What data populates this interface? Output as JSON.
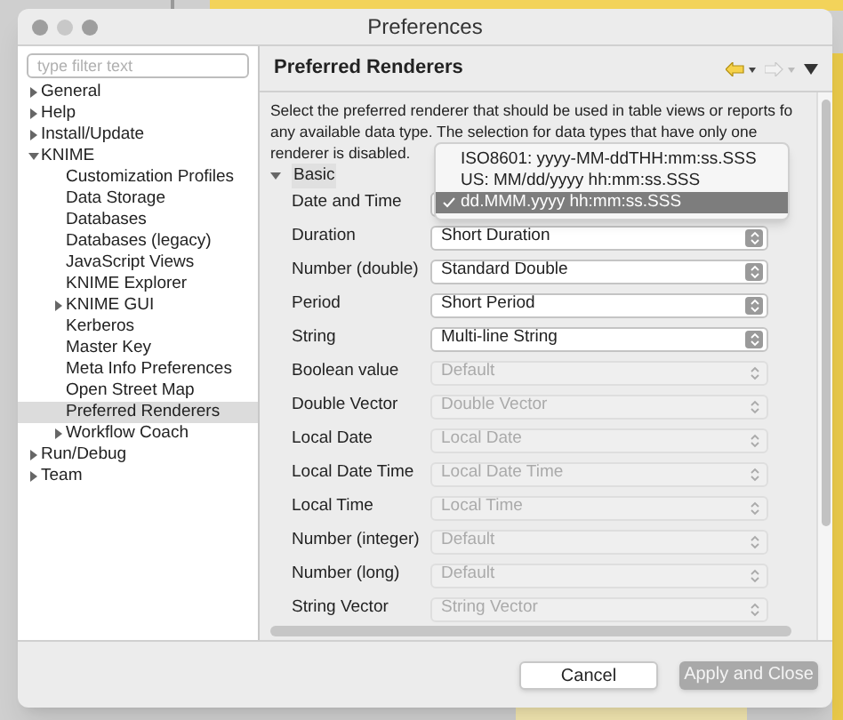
{
  "window": {
    "title": "Preferences"
  },
  "filter": {
    "placeholder": "type filter text"
  },
  "tree": [
    {
      "label": "General",
      "expanded": false,
      "selected": false
    },
    {
      "label": "Help",
      "expanded": false,
      "selected": false
    },
    {
      "label": "Install/Update",
      "expanded": false,
      "selected": false
    },
    {
      "label": "KNIME",
      "expanded": true,
      "selected": false,
      "children": [
        {
          "label": "Customization Profiles",
          "selected": false
        },
        {
          "label": "Data Storage",
          "selected": false
        },
        {
          "label": "Databases",
          "selected": false
        },
        {
          "label": "Databases (legacy)",
          "selected": false
        },
        {
          "label": "JavaScript Views",
          "selected": false
        },
        {
          "label": "KNIME Explorer",
          "selected": false
        },
        {
          "label": "KNIME GUI",
          "expanded": false,
          "selected": false
        },
        {
          "label": "Kerberos",
          "selected": false
        },
        {
          "label": "Master Key",
          "selected": false
        },
        {
          "label": "Meta Info Preferences",
          "selected": false
        },
        {
          "label": "Open Street Map",
          "selected": false
        },
        {
          "label": "Preferred Renderers",
          "selected": true
        },
        {
          "label": "Workflow Coach",
          "expanded": false,
          "selected": false
        }
      ]
    },
    {
      "label": "Run/Debug",
      "expanded": false,
      "selected": false
    },
    {
      "label": "Team",
      "expanded": false,
      "selected": false
    }
  ],
  "page": {
    "title": "Preferred Renderers",
    "description": [
      "Select the preferred renderer that should be used in table views or reports fo",
      "any available data type. The selection for data types that have only one",
      "renderer is disabled."
    ],
    "section": {
      "label": "Basic",
      "expanded": true
    },
    "rows": [
      {
        "label": "Date and Time",
        "disabled": false
      },
      {
        "label": "Duration",
        "value": "Short Duration",
        "disabled": false
      },
      {
        "label": "Number (double)",
        "value": "Standard Double",
        "disabled": false
      },
      {
        "label": "Period",
        "value": "Short Period",
        "disabled": false
      },
      {
        "label": "String",
        "value": "Multi-line String",
        "disabled": false
      },
      {
        "label": "Boolean value",
        "value": "Default",
        "disabled": true
      },
      {
        "label": "Double Vector",
        "value": "Double Vector",
        "disabled": true
      },
      {
        "label": "Local Date",
        "value": "Local Date",
        "disabled": true
      },
      {
        "label": "Local Date Time",
        "value": "Local Date Time",
        "disabled": true
      },
      {
        "label": "Local Time",
        "value": "Local Time",
        "disabled": true
      },
      {
        "label": "Number (integer)",
        "value": "Default",
        "disabled": true
      },
      {
        "label": "Number (long)",
        "value": "Default",
        "disabled": true
      },
      {
        "label": "String Vector",
        "value": "String Vector",
        "disabled": true
      }
    ],
    "popup": {
      "options": [
        {
          "label": "ISO8601: yyyy-MM-ddTHH:mm:ss.SSS",
          "selected": false
        },
        {
          "label": "US: MM/dd/yyyy hh:mm:ss.SSS",
          "selected": false
        },
        {
          "label": "dd.MMM.yyyy hh:mm:ss.SSS",
          "selected": true
        }
      ]
    }
  },
  "buttons": [
    {
      "label": "Cancel",
      "kind": "secondary"
    },
    {
      "label": "Apply and Close",
      "kind": "primary"
    }
  ]
}
